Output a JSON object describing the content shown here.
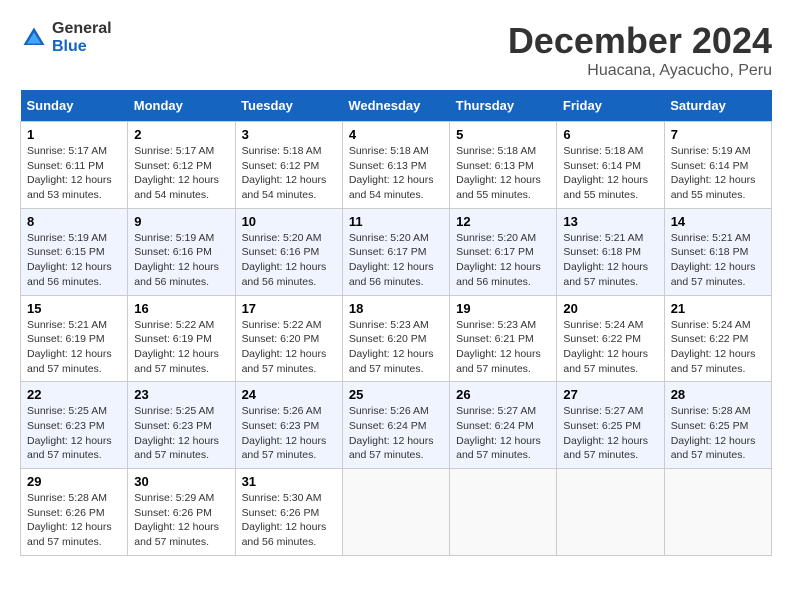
{
  "header": {
    "logo_general": "General",
    "logo_blue": "Blue",
    "month_title": "December 2024",
    "location": "Huacana, Ayacucho, Peru"
  },
  "weekdays": [
    "Sunday",
    "Monday",
    "Tuesday",
    "Wednesday",
    "Thursday",
    "Friday",
    "Saturday"
  ],
  "weeks": [
    [
      {
        "day": "1",
        "sunrise": "5:17 AM",
        "sunset": "6:11 PM",
        "daylight": "12 hours and 53 minutes."
      },
      {
        "day": "2",
        "sunrise": "5:17 AM",
        "sunset": "6:12 PM",
        "daylight": "12 hours and 54 minutes."
      },
      {
        "day": "3",
        "sunrise": "5:18 AM",
        "sunset": "6:12 PM",
        "daylight": "12 hours and 54 minutes."
      },
      {
        "day": "4",
        "sunrise": "5:18 AM",
        "sunset": "6:13 PM",
        "daylight": "12 hours and 54 minutes."
      },
      {
        "day": "5",
        "sunrise": "5:18 AM",
        "sunset": "6:13 PM",
        "daylight": "12 hours and 55 minutes."
      },
      {
        "day": "6",
        "sunrise": "5:18 AM",
        "sunset": "6:14 PM",
        "daylight": "12 hours and 55 minutes."
      },
      {
        "day": "7",
        "sunrise": "5:19 AM",
        "sunset": "6:14 PM",
        "daylight": "12 hours and 55 minutes."
      }
    ],
    [
      {
        "day": "8",
        "sunrise": "5:19 AM",
        "sunset": "6:15 PM",
        "daylight": "12 hours and 56 minutes."
      },
      {
        "day": "9",
        "sunrise": "5:19 AM",
        "sunset": "6:16 PM",
        "daylight": "12 hours and 56 minutes."
      },
      {
        "day": "10",
        "sunrise": "5:20 AM",
        "sunset": "6:16 PM",
        "daylight": "12 hours and 56 minutes."
      },
      {
        "day": "11",
        "sunrise": "5:20 AM",
        "sunset": "6:17 PM",
        "daylight": "12 hours and 56 minutes."
      },
      {
        "day": "12",
        "sunrise": "5:20 AM",
        "sunset": "6:17 PM",
        "daylight": "12 hours and 56 minutes."
      },
      {
        "day": "13",
        "sunrise": "5:21 AM",
        "sunset": "6:18 PM",
        "daylight": "12 hours and 57 minutes."
      },
      {
        "day": "14",
        "sunrise": "5:21 AM",
        "sunset": "6:18 PM",
        "daylight": "12 hours and 57 minutes."
      }
    ],
    [
      {
        "day": "15",
        "sunrise": "5:21 AM",
        "sunset": "6:19 PM",
        "daylight": "12 hours and 57 minutes."
      },
      {
        "day": "16",
        "sunrise": "5:22 AM",
        "sunset": "6:19 PM",
        "daylight": "12 hours and 57 minutes."
      },
      {
        "day": "17",
        "sunrise": "5:22 AM",
        "sunset": "6:20 PM",
        "daylight": "12 hours and 57 minutes."
      },
      {
        "day": "18",
        "sunrise": "5:23 AM",
        "sunset": "6:20 PM",
        "daylight": "12 hours and 57 minutes."
      },
      {
        "day": "19",
        "sunrise": "5:23 AM",
        "sunset": "6:21 PM",
        "daylight": "12 hours and 57 minutes."
      },
      {
        "day": "20",
        "sunrise": "5:24 AM",
        "sunset": "6:22 PM",
        "daylight": "12 hours and 57 minutes."
      },
      {
        "day": "21",
        "sunrise": "5:24 AM",
        "sunset": "6:22 PM",
        "daylight": "12 hours and 57 minutes."
      }
    ],
    [
      {
        "day": "22",
        "sunrise": "5:25 AM",
        "sunset": "6:23 PM",
        "daylight": "12 hours and 57 minutes."
      },
      {
        "day": "23",
        "sunrise": "5:25 AM",
        "sunset": "6:23 PM",
        "daylight": "12 hours and 57 minutes."
      },
      {
        "day": "24",
        "sunrise": "5:26 AM",
        "sunset": "6:23 PM",
        "daylight": "12 hours and 57 minutes."
      },
      {
        "day": "25",
        "sunrise": "5:26 AM",
        "sunset": "6:24 PM",
        "daylight": "12 hours and 57 minutes."
      },
      {
        "day": "26",
        "sunrise": "5:27 AM",
        "sunset": "6:24 PM",
        "daylight": "12 hours and 57 minutes."
      },
      {
        "day": "27",
        "sunrise": "5:27 AM",
        "sunset": "6:25 PM",
        "daylight": "12 hours and 57 minutes."
      },
      {
        "day": "28",
        "sunrise": "5:28 AM",
        "sunset": "6:25 PM",
        "daylight": "12 hours and 57 minutes."
      }
    ],
    [
      {
        "day": "29",
        "sunrise": "5:28 AM",
        "sunset": "6:26 PM",
        "daylight": "12 hours and 57 minutes."
      },
      {
        "day": "30",
        "sunrise": "5:29 AM",
        "sunset": "6:26 PM",
        "daylight": "12 hours and 57 minutes."
      },
      {
        "day": "31",
        "sunrise": "5:30 AM",
        "sunset": "6:26 PM",
        "daylight": "12 hours and 56 minutes."
      },
      null,
      null,
      null,
      null
    ]
  ]
}
